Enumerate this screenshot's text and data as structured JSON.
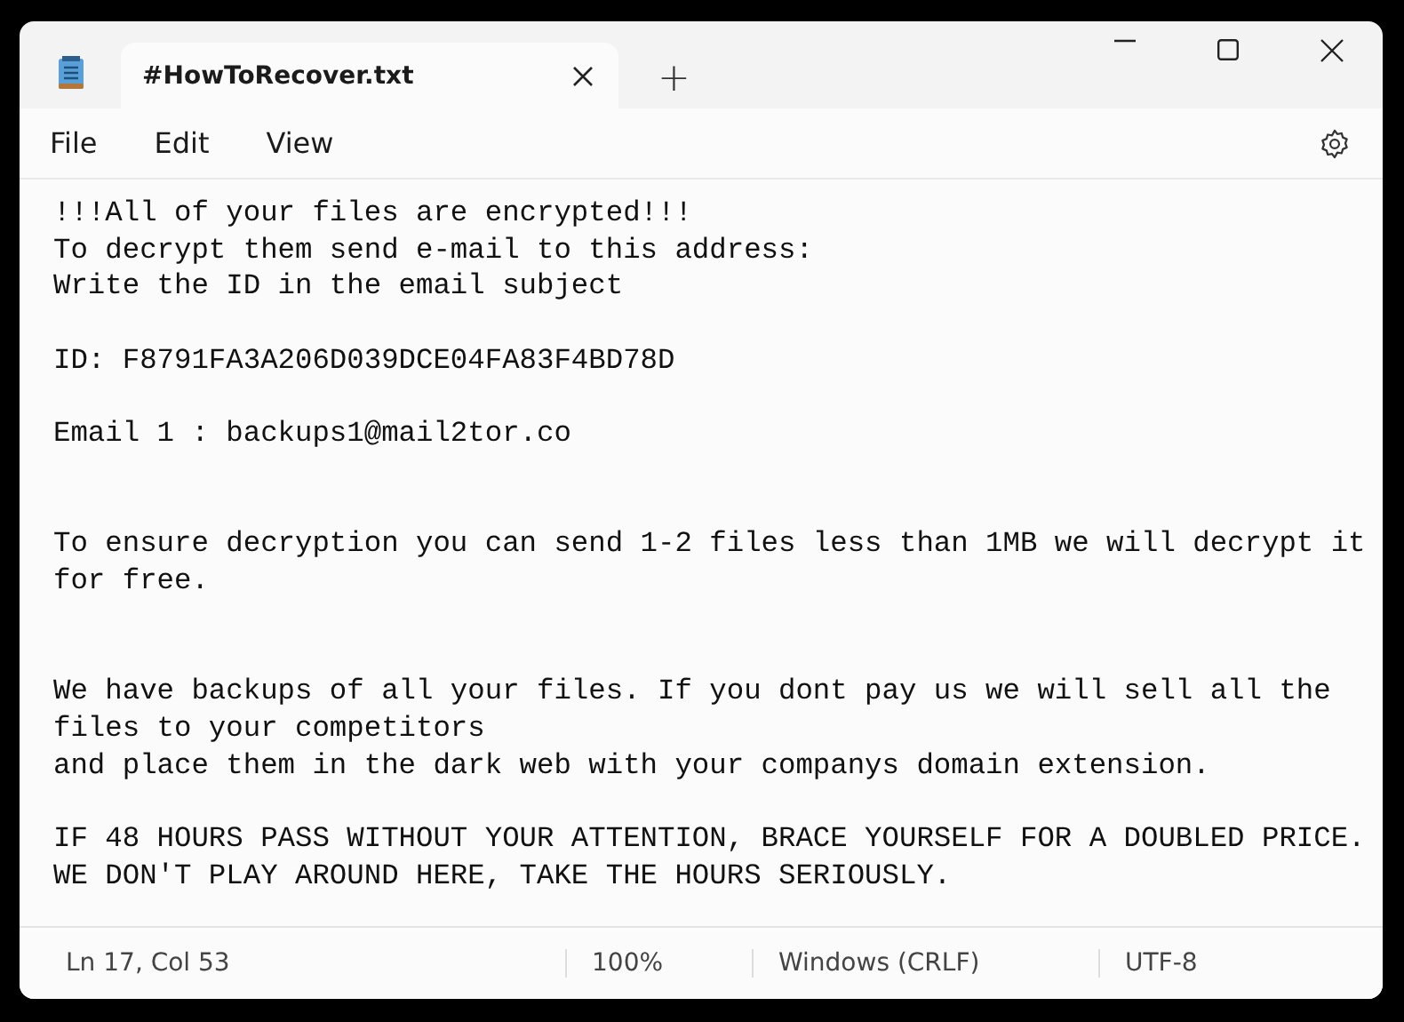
{
  "tabs": [
    {
      "label": "#HowToRecover.txt",
      "selected": true
    }
  ],
  "title_bar": {
    "new_tab": "+"
  },
  "menu": [
    "File",
    "Edit",
    "View"
  ],
  "document": {
    "text": "!!!All of your files are encrypted!!!\nTo decrypt them send e-mail to this address:\nWrite the ID in the email subject\n\nID: F8791FA3A206D039DCE04FA83F4BD78D\n\nEmail 1 : backups1@mail2tor.co\n\n\nTo ensure decryption you can send 1-2 files less than 1MB we will decrypt it\nfor free.\n\n\nWe have backups of all your files. If you dont pay us we will sell all the\nfiles to your competitors\nand place them in the dark web with your companys domain extension.\n\nIF 48 HOURS PASS WITHOUT YOUR ATTENTION, BRACE YOURSELF FOR A DOUBLED PRICE.\nWE DON'T PLAY AROUND HERE, TAKE THE HOURS SERIOUSLY."
  },
  "status_bar": [
    "Ln 17, Col 53",
    "100%",
    "Windows (CRLF)",
    "UTF-8"
  ]
}
